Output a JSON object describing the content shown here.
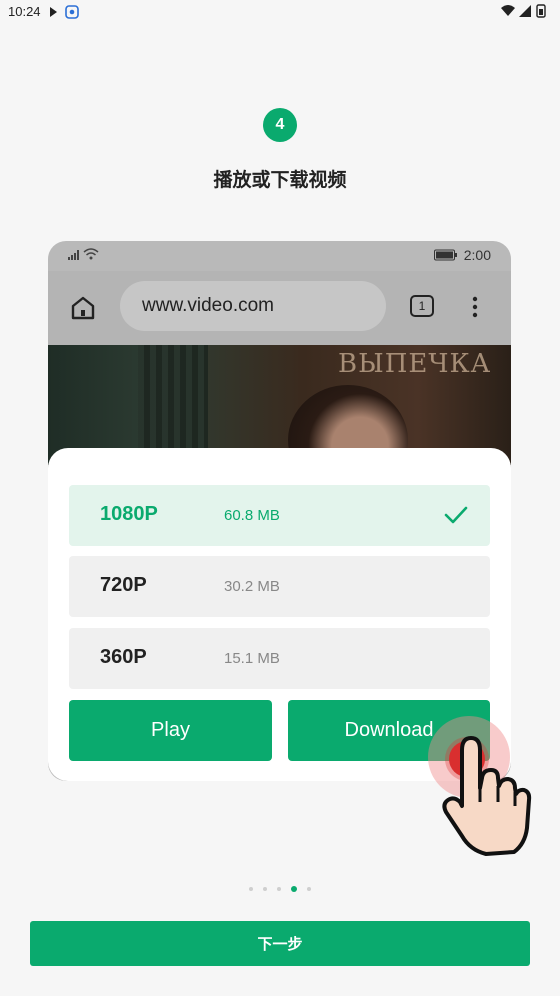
{
  "status_bar": {
    "time": "10:24"
  },
  "step": {
    "number": "4",
    "title": "播放或下载视频"
  },
  "mock_phone": {
    "status_time": "2:00",
    "url": "www.video.com",
    "tab_count": "1",
    "video_overlay_text": "ВЫПЕЧКА"
  },
  "quality_options": [
    {
      "label": "1080P",
      "size": "60.8 MB",
      "selected": true
    },
    {
      "label": "720P",
      "size": "30.2 MB",
      "selected": false
    },
    {
      "label": "360P",
      "size": "15.1 MB",
      "selected": false
    }
  ],
  "actions": {
    "play_label": "Play",
    "download_label": "Download"
  },
  "pager": {
    "total": 5,
    "active_index": 3
  },
  "footer": {
    "next_label": "下一步"
  },
  "colors": {
    "accent": "#0aaa6e",
    "selected_bg": "#e3f4ec",
    "tap": "#d92f2f"
  }
}
